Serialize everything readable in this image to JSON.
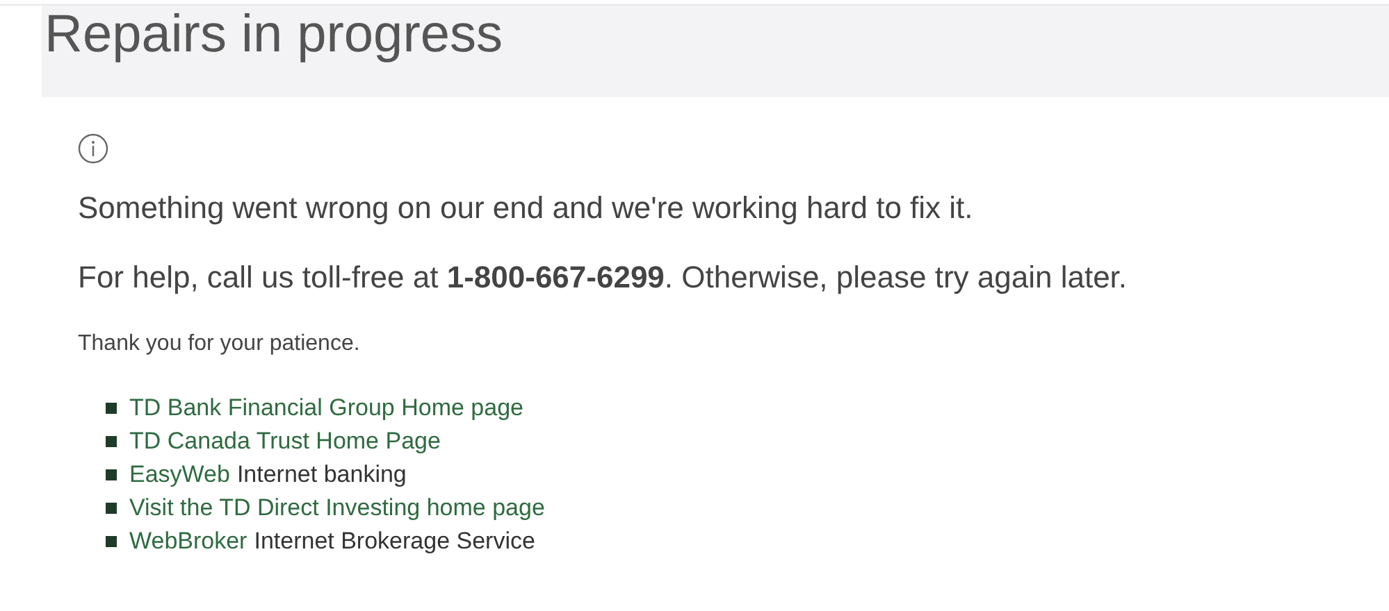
{
  "page_title": "Repairs in progress",
  "messages": [
    "Something went wrong on our end and we're working hard to fix it.",
    "For help, call us toll-free at **1-800-667-6299**. Otherwise, please try again later."
  ],
  "thanks": "Thank you for your patience.",
  "links": [
    {
      "link": "TD Bank Financial Group Home page"
    },
    {
      "link": "TD Canada Trust Home Page"
    },
    {
      "link": "EasyWeb",
      "text": "Internet banking"
    },
    {
      "link": "Visit the TD Direct Investing home page"
    },
    {
      "link": "WebBroker",
      "text": "Internet Brokerage Service"
    }
  ]
}
